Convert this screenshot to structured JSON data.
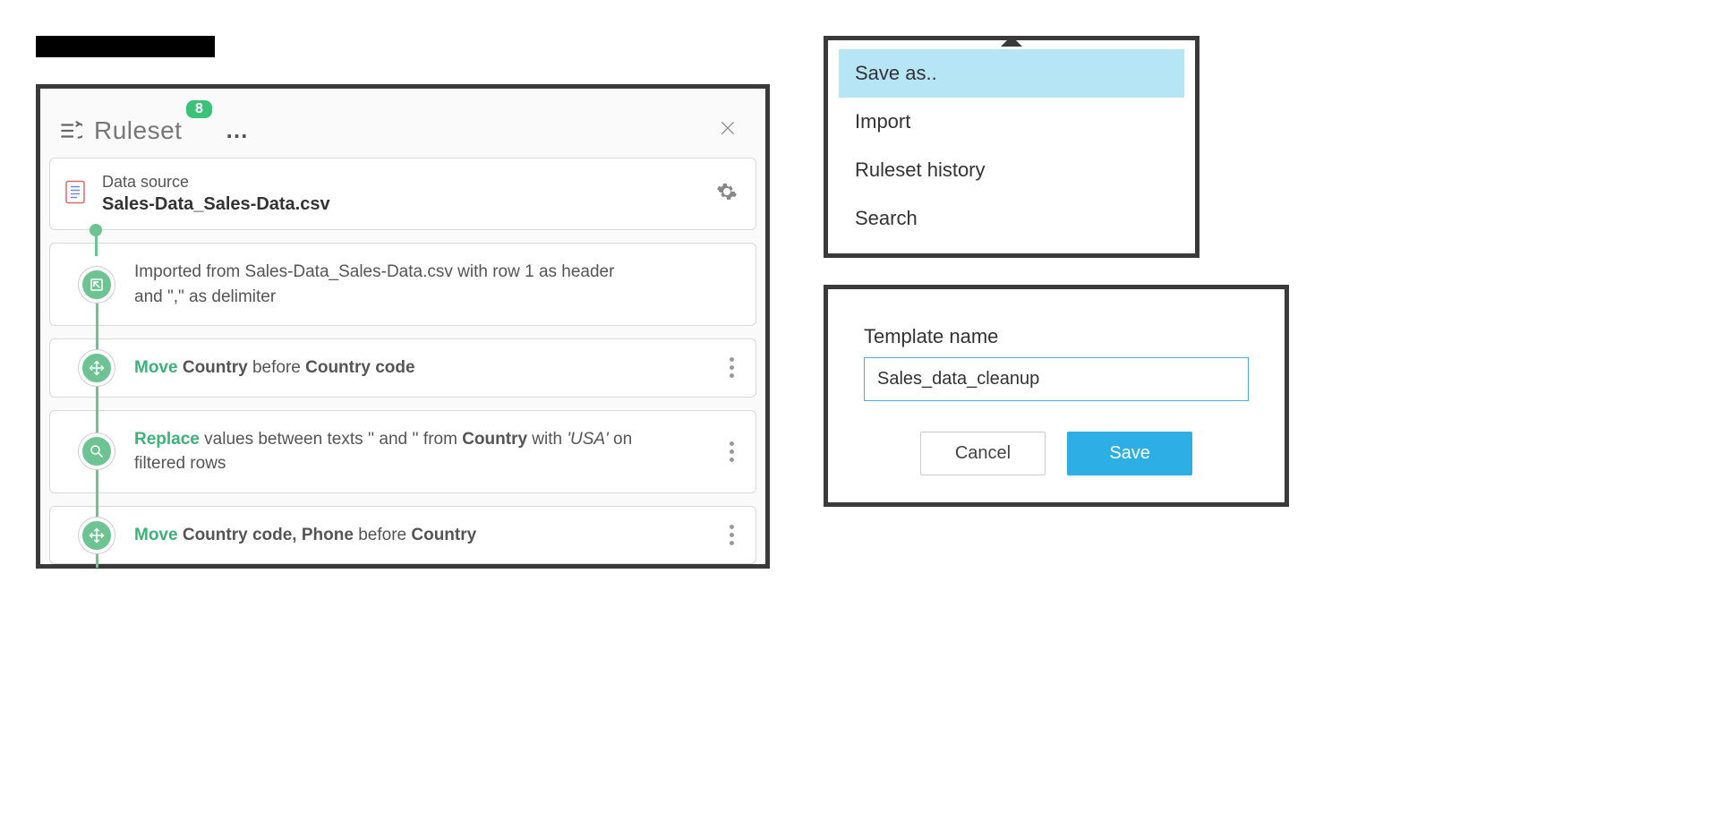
{
  "ruleset": {
    "title": "Ruleset",
    "badge": "8",
    "datasource": {
      "label": "Data source",
      "filename": "Sales-Data_Sales-Data.csv"
    },
    "steps": {
      "import": {
        "prefix": "Imported from Sales-Data_Sales-Data.csv with row 1 as header and \",\" as delimiter"
      },
      "move1": {
        "action": "Move",
        "col": "Country",
        "mid": " before ",
        "target": "Country code"
      },
      "replace": {
        "action": "Replace",
        "mid1": " values between texts '' and '' from ",
        "col": "Country",
        "mid2": " with ",
        "value": "'USA'",
        "suffix": " on filtered rows"
      },
      "move2": {
        "action": "Move",
        "cols": "Country code, Phone",
        "mid": " before ",
        "target": "Country"
      }
    }
  },
  "menu": {
    "items": [
      "Save as..",
      "Import",
      "Ruleset history",
      "Search"
    ],
    "active_index": 0
  },
  "dialog": {
    "field_label": "Template name",
    "value": "Sales_data_cleanup",
    "cancel": "Cancel",
    "save": "Save"
  }
}
